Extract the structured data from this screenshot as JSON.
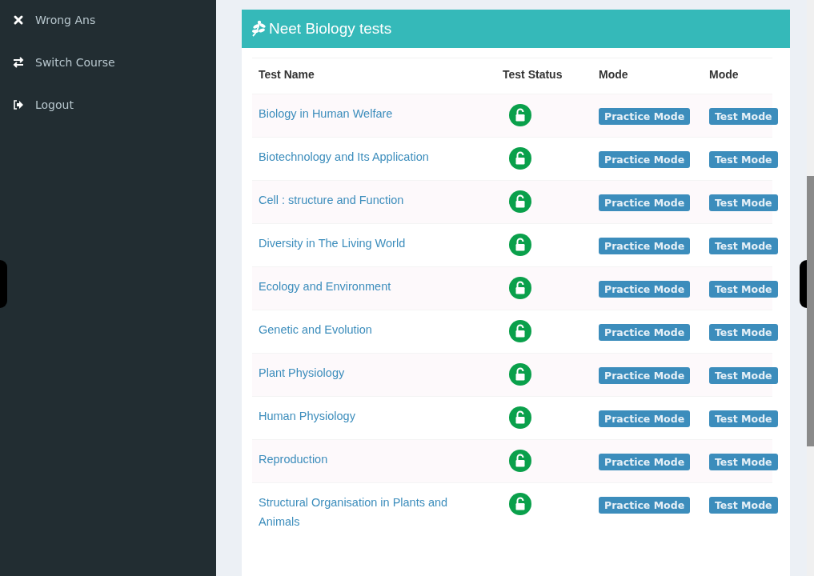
{
  "sidebar": {
    "items": [
      {
        "label": "Wrong Ans"
      },
      {
        "label": "Switch Course"
      },
      {
        "label": "Logout"
      }
    ]
  },
  "panel": {
    "title": "Neet Biology tests"
  },
  "table": {
    "columns": [
      "Test Name",
      "Test Status",
      "Mode",
      "Mode"
    ],
    "rows": [
      {
        "name": "Biology in Human Welfare",
        "unlocked": true,
        "practice": "Practice Mode",
        "test": "Test Mode"
      },
      {
        "name": "Biotechnology and Its Application",
        "unlocked": true,
        "practice": "Practice Mode",
        "test": "Test Mode"
      },
      {
        "name": "Cell : structure and Function",
        "unlocked": true,
        "practice": "Practice Mode",
        "test": "Test Mode"
      },
      {
        "name": "Diversity in The Living World",
        "unlocked": true,
        "practice": "Practice Mode",
        "test": "Test Mode"
      },
      {
        "name": "Ecology and Environment",
        "unlocked": true,
        "practice": "Practice Mode",
        "test": "Test Mode"
      },
      {
        "name": "Genetic and Evolution",
        "unlocked": true,
        "practice": "Practice Mode",
        "test": "Test Mode"
      },
      {
        "name": "Plant Physiology",
        "unlocked": true,
        "practice": "Practice Mode",
        "test": "Test Mode"
      },
      {
        "name": "Human Physiology",
        "unlocked": true,
        "practice": "Practice Mode",
        "test": "Test Mode"
      },
      {
        "name": "Reproduction",
        "unlocked": true,
        "practice": "Practice Mode",
        "test": "Test Mode"
      },
      {
        "name": "Structural Organisation in Plants and Animals",
        "unlocked": true,
        "practice": "Practice Mode",
        "test": "Test Mode"
      }
    ]
  }
}
